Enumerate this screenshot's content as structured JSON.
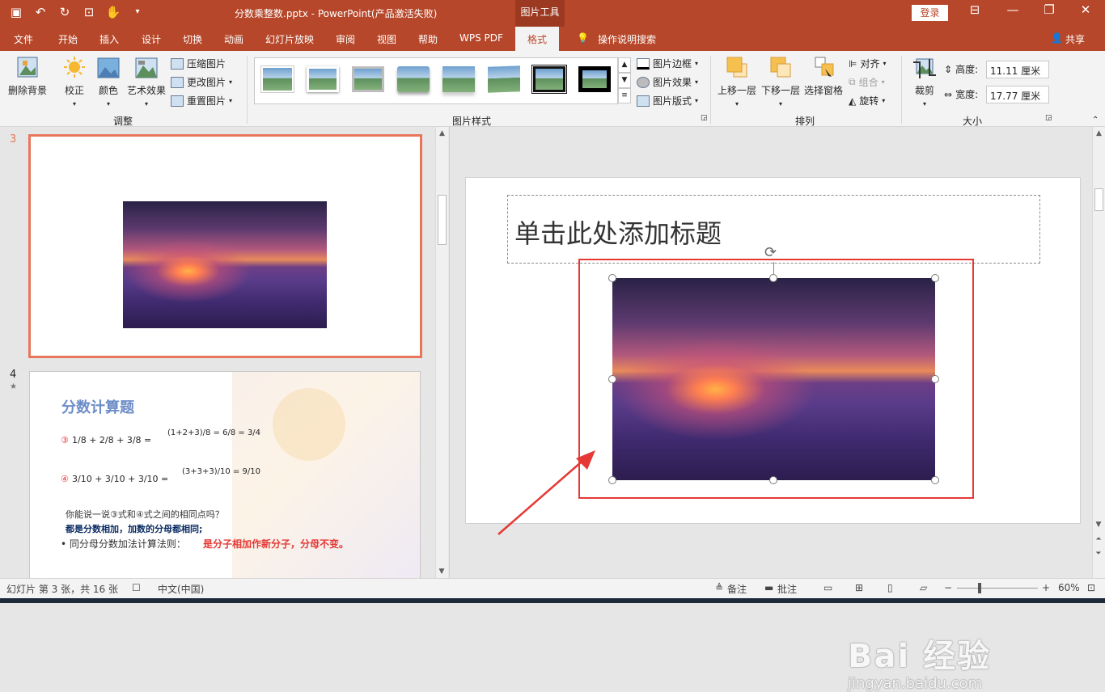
{
  "titlebar": {
    "doc_title": "分数乘整数.pptx  -  PowerPoint(产品激活失败)",
    "context_tab_group": "图片工具",
    "login_label": "登录"
  },
  "tabs": [
    "文件",
    "开始",
    "插入",
    "设计",
    "切换",
    "动画",
    "幻灯片放映",
    "审阅",
    "视图",
    "帮助",
    "WPS PDF",
    "格式"
  ],
  "tell_me": "操作说明搜索",
  "share": "共享",
  "ribbon": {
    "adjust": {
      "remove_bg": "删除背景",
      "correct": "校正",
      "color": "颜色",
      "art_effects": "艺术效果",
      "compress": "压缩图片",
      "change": "更改图片",
      "reset": "重置图片",
      "label": "调整"
    },
    "styles": {
      "border": "图片边框",
      "effects": "图片效果",
      "layout": "图片版式",
      "label": "图片样式"
    },
    "arrange": {
      "bring_forward": "上移一层",
      "send_backward": "下移一层",
      "selection_pane": "选择窗格",
      "align": "对齐",
      "group": "组合",
      "rotate": "旋转",
      "label": "排列"
    },
    "size": {
      "crop": "裁剪",
      "height_label": "高度:",
      "height_value": "11.11 厘米",
      "width_label": "宽度:",
      "width_value": "17.77 厘米",
      "label": "大小"
    }
  },
  "thumbnails": {
    "slide3_num": "3",
    "slide4_num": "4",
    "slide4_star": "★",
    "slide4": {
      "title": "分数计算题",
      "eq1_num": "③",
      "eq1_frac": "1/8 + 2/8 + 3/8 =",
      "eq1_result": "(1+2+3)/8 = 6/8 = 3/4",
      "eq2_num": "④",
      "eq2_frac": "3/10 + 3/10 + 3/10 =",
      "eq2_result": "(3+3+3)/10 = 9/10",
      "question": "你能说一说③式和④式之间的相同点吗？",
      "answer": "都是分数相加，加数的分母都相同;",
      "rule_prefix": "• 同分母分数加法计算法则：",
      "rule_red": "是分子相加作新分子，分母不变。"
    }
  },
  "slide": {
    "title_placeholder": "单击此处添加标题"
  },
  "statusbar": {
    "slide_info": "幻灯片 第 3 张，共 16 张",
    "language": "中文(中国)",
    "notes": "备注",
    "comments": "批注",
    "zoom": "60%"
  },
  "watermark": {
    "brand": "Bai  经验",
    "url": "jingyan.baidu.com"
  }
}
